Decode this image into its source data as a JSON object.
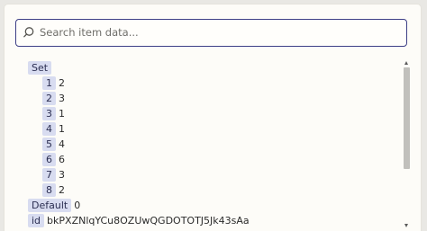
{
  "search": {
    "placeholder": "Search item data..."
  },
  "tree": {
    "set_key": "Set",
    "set_items": [
      {
        "key": "1",
        "value": "2"
      },
      {
        "key": "2",
        "value": "3"
      },
      {
        "key": "3",
        "value": "1"
      },
      {
        "key": "4",
        "value": "1"
      },
      {
        "key": "5",
        "value": "4"
      },
      {
        "key": "6",
        "value": "6"
      },
      {
        "key": "7",
        "value": "3"
      },
      {
        "key": "8",
        "value": "2"
      }
    ],
    "default_key": "Default",
    "default_value": "0",
    "id_key": "id",
    "id_value": "bkPXZNlqYCu8OZUwQGDOTOTJ5Jk43sAa"
  },
  "colors": {
    "accent": "#3d3f86",
    "key_bg": "#d8dcf0"
  },
  "icons": {
    "search": "search-icon"
  }
}
